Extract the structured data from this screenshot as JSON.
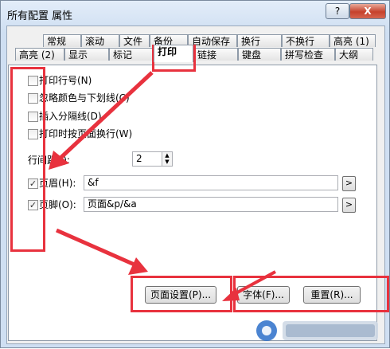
{
  "window": {
    "title": "所有配置 属性",
    "help_label": "?",
    "close_label": "X"
  },
  "tabs_row1": [
    "常规",
    "滚动",
    "文件",
    "备份",
    "自动保存",
    "换行",
    "不换行",
    "高亮 (1)"
  ],
  "tabs_row2": [
    "高亮 (2)",
    "显示",
    "标记",
    "打印",
    "链接",
    "键盘",
    "拼写检查",
    "大纲"
  ],
  "active_tab": "打印",
  "options": [
    {
      "label": "打印行号(N)",
      "checked": false
    },
    {
      "label": "忽略颜色与下划线(C)",
      "checked": false
    },
    {
      "label": "插入分隔线(D)",
      "checked": false
    },
    {
      "label": "打印时按页面换行(W)",
      "checked": false
    }
  ],
  "line_spacing": {
    "label": "行间距(I):",
    "value": "2"
  },
  "header": {
    "label": "页眉(H):",
    "checked": true,
    "value": "&f",
    "button": ">"
  },
  "footer": {
    "label": "页脚(O):",
    "checked": true,
    "value": "页面&p/&a",
    "button": ">"
  },
  "buttons": {
    "page_setup": "页面设置(P)...",
    "font": "字体(F)...",
    "reset": "重置(R)..."
  },
  "colors": {
    "annotation": "#e8323e"
  }
}
